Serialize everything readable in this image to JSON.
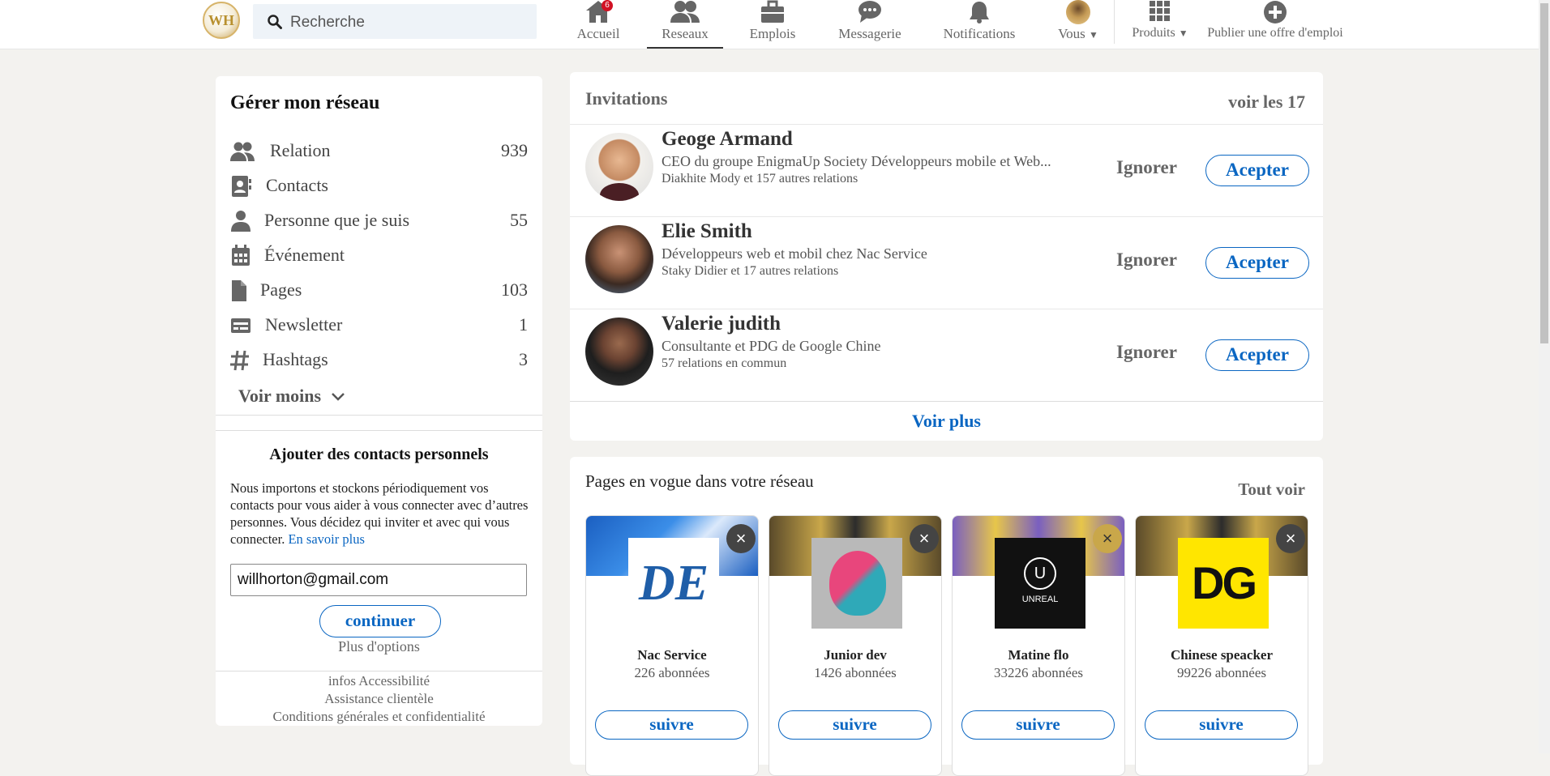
{
  "header": {
    "logo_text": "WH",
    "search_placeholder": "Recherche",
    "nav": [
      {
        "label": "Accueil",
        "icon": "home-icon",
        "badge": "6"
      },
      {
        "label": "Reseaux",
        "icon": "network-icon"
      },
      {
        "label": "Emplois",
        "icon": "briefcase-icon"
      },
      {
        "label": "Messagerie",
        "icon": "message-icon"
      },
      {
        "label": "Notifications",
        "icon": "bell-icon"
      },
      {
        "label": "Vous",
        "icon": "avatar"
      },
      {
        "label": "Produits",
        "icon": "grid-icon"
      },
      {
        "label": "Publier une offre d'emploi",
        "icon": "plus-circle-icon"
      }
    ]
  },
  "sidebar": {
    "title": "Gérer mon réseau",
    "items": [
      {
        "label": "Relation",
        "count": "939",
        "icon": "people-icon"
      },
      {
        "label": "Contacts",
        "count": "",
        "icon": "contact-book-icon"
      },
      {
        "label": "Personne que je suis",
        "count": "55",
        "icon": "person-icon"
      },
      {
        "label": "Événement",
        "count": "",
        "icon": "calendar-icon"
      },
      {
        "label": "Pages",
        "count": "103",
        "icon": "page-icon"
      },
      {
        "label": "Newsletter",
        "count": "1",
        "icon": "newsletter-icon"
      },
      {
        "label": "Hashtags",
        "count": "3",
        "icon": "hashtag-icon"
      }
    ],
    "toggle_label": "Voir moins"
  },
  "contacts": {
    "title": "Ajouter des contacts personnels",
    "desc": "Nous importons et stockons périodiquement vos contacts pour vous aider à vous connecter avec d’autres personnes. Vous décidez qui inviter et avec qui vous connecter.",
    "learn_more": "En savoir plus",
    "email_value": "willhorton@gmail.com",
    "continue_label": "continuer",
    "more_options": "Plus d'options"
  },
  "footer": {
    "links": [
      "infos Accessibilité",
      "Assistance clientèle",
      "Conditions générales et confidentialité"
    ]
  },
  "invitations": {
    "title": "Invitations",
    "see_all": "voir les 17",
    "ignore_label": "Ignorer",
    "accept_label": "Acepter",
    "items": [
      {
        "name": "Geoge Armand",
        "headline": "CEO du groupe EnigmaUp Society Développeurs mobile et Web...",
        "mutual": "Diakhite Mody et 157 autres relations"
      },
      {
        "name": "Elie Smith",
        "headline": "Développeurs web et mobil chez Nac Service",
        "mutual": "Staky Didier et 17 autres relations"
      },
      {
        "name": "Valerie judith",
        "headline": "Consultante et PDG de Google Chine",
        "mutual": "57 relations en commun"
      }
    ],
    "see_more": "Voir plus"
  },
  "pages": {
    "title": "Pages en vogue dans votre réseau",
    "see_all": "Tout voir",
    "follow_label": "suivre",
    "dismiss_icon": "close-icon",
    "items": [
      {
        "name": "Nac Service",
        "followers": "226 abonnées",
        "logo_text": "DE"
      },
      {
        "name": "Junior dev",
        "followers": "1426 abonnées",
        "logo_text": ""
      },
      {
        "name": "Matine flo",
        "followers": "33226 abonnées",
        "logo_text": "UNREAL"
      },
      {
        "name": "Chinese speacker",
        "followers": "99226 abonnées",
        "logo_text": "DG"
      }
    ]
  },
  "colors": {
    "accent": "#0a66c2",
    "background": "#f3f2ef",
    "badge": "#d11124"
  }
}
